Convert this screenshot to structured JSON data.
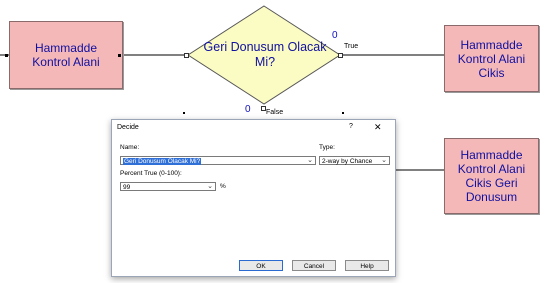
{
  "flowchart": {
    "modules": {
      "kontrol_alani": {
        "label": [
          "Hammadde",
          "Kontrol Alani"
        ]
      },
      "kontrol_alani_cikis": {
        "label": [
          "Hammadde",
          "Kontrol Alani",
          "Cikis"
        ]
      },
      "kontrol_alani_cikis_geri_donusum": {
        "label": [
          "Hammadde",
          "Kontrol Alani",
          "Cikis Geri",
          "Donusum"
        ]
      }
    },
    "decide": {
      "label": [
        "Geri Donusum Olacak",
        "Mi?"
      ],
      "true_label": "True",
      "false_label": "False",
      "true_count": "0",
      "false_count": "0"
    }
  },
  "dialog": {
    "title": "Decide",
    "help_glyph": "?",
    "close_glyph": "✕",
    "name_label": "Name:",
    "name_value": "Geri Donusum Olacak Mi?",
    "type_label": "Type:",
    "type_value": "2-way by Chance",
    "percent_label": "Percent True (0-100):",
    "percent_value": "99",
    "percent_unit": "%",
    "ok_label": "OK",
    "cancel_label": "Cancel",
    "help_label": "Help"
  },
  "colors": {
    "module_fill": "#f5b8b8",
    "module_text": "#1010a0",
    "decide_fill": "#fbfbc4",
    "selection": "#2f6fd8"
  },
  "icons": [
    "chevron-down-icon",
    "close-icon",
    "help-icon"
  ]
}
